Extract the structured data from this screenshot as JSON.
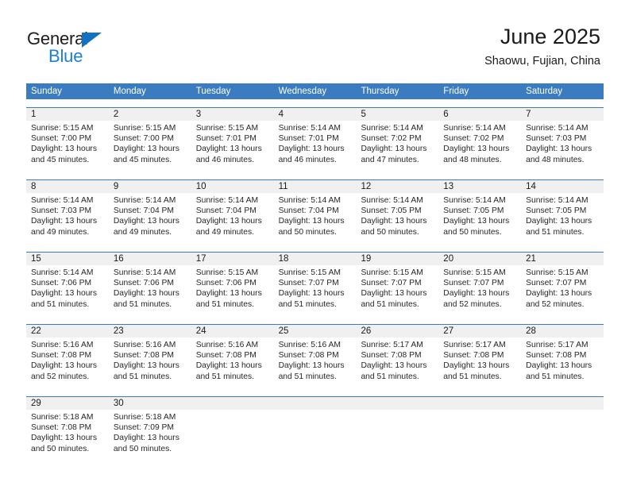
{
  "logo": {
    "word1": "General",
    "word2": "Blue",
    "triangle_color": "#1271c0",
    "blue_color": "#1b7fd4"
  },
  "header": {
    "title": "June 2025",
    "subtitle": "Shaowu, Fujian, China"
  },
  "theme": {
    "header_blue": "#3a7cbf",
    "daynum_band": "#f0f0f0",
    "text": "#1a1a1a"
  },
  "weekdays": [
    "Sunday",
    "Monday",
    "Tuesday",
    "Wednesday",
    "Thursday",
    "Friday",
    "Saturday"
  ],
  "weeks": [
    [
      {
        "day": "1",
        "sunrise": "Sunrise: 5:15 AM",
        "sunset": "Sunset: 7:00 PM",
        "daylight": "Daylight: 13 hours and 45 minutes."
      },
      {
        "day": "2",
        "sunrise": "Sunrise: 5:15 AM",
        "sunset": "Sunset: 7:00 PM",
        "daylight": "Daylight: 13 hours and 45 minutes."
      },
      {
        "day": "3",
        "sunrise": "Sunrise: 5:15 AM",
        "sunset": "Sunset: 7:01 PM",
        "daylight": "Daylight: 13 hours and 46 minutes."
      },
      {
        "day": "4",
        "sunrise": "Sunrise: 5:14 AM",
        "sunset": "Sunset: 7:01 PM",
        "daylight": "Daylight: 13 hours and 46 minutes."
      },
      {
        "day": "5",
        "sunrise": "Sunrise: 5:14 AM",
        "sunset": "Sunset: 7:02 PM",
        "daylight": "Daylight: 13 hours and 47 minutes."
      },
      {
        "day": "6",
        "sunrise": "Sunrise: 5:14 AM",
        "sunset": "Sunset: 7:02 PM",
        "daylight": "Daylight: 13 hours and 48 minutes."
      },
      {
        "day": "7",
        "sunrise": "Sunrise: 5:14 AM",
        "sunset": "Sunset: 7:03 PM",
        "daylight": "Daylight: 13 hours and 48 minutes."
      }
    ],
    [
      {
        "day": "8",
        "sunrise": "Sunrise: 5:14 AM",
        "sunset": "Sunset: 7:03 PM",
        "daylight": "Daylight: 13 hours and 49 minutes."
      },
      {
        "day": "9",
        "sunrise": "Sunrise: 5:14 AM",
        "sunset": "Sunset: 7:04 PM",
        "daylight": "Daylight: 13 hours and 49 minutes."
      },
      {
        "day": "10",
        "sunrise": "Sunrise: 5:14 AM",
        "sunset": "Sunset: 7:04 PM",
        "daylight": "Daylight: 13 hours and 49 minutes."
      },
      {
        "day": "11",
        "sunrise": "Sunrise: 5:14 AM",
        "sunset": "Sunset: 7:04 PM",
        "daylight": "Daylight: 13 hours and 50 minutes."
      },
      {
        "day": "12",
        "sunrise": "Sunrise: 5:14 AM",
        "sunset": "Sunset: 7:05 PM",
        "daylight": "Daylight: 13 hours and 50 minutes."
      },
      {
        "day": "13",
        "sunrise": "Sunrise: 5:14 AM",
        "sunset": "Sunset: 7:05 PM",
        "daylight": "Daylight: 13 hours and 50 minutes."
      },
      {
        "day": "14",
        "sunrise": "Sunrise: 5:14 AM",
        "sunset": "Sunset: 7:05 PM",
        "daylight": "Daylight: 13 hours and 51 minutes."
      }
    ],
    [
      {
        "day": "15",
        "sunrise": "Sunrise: 5:14 AM",
        "sunset": "Sunset: 7:06 PM",
        "daylight": "Daylight: 13 hours and 51 minutes."
      },
      {
        "day": "16",
        "sunrise": "Sunrise: 5:14 AM",
        "sunset": "Sunset: 7:06 PM",
        "daylight": "Daylight: 13 hours and 51 minutes."
      },
      {
        "day": "17",
        "sunrise": "Sunrise: 5:15 AM",
        "sunset": "Sunset: 7:06 PM",
        "daylight": "Daylight: 13 hours and 51 minutes."
      },
      {
        "day": "18",
        "sunrise": "Sunrise: 5:15 AM",
        "sunset": "Sunset: 7:07 PM",
        "daylight": "Daylight: 13 hours and 51 minutes."
      },
      {
        "day": "19",
        "sunrise": "Sunrise: 5:15 AM",
        "sunset": "Sunset: 7:07 PM",
        "daylight": "Daylight: 13 hours and 51 minutes."
      },
      {
        "day": "20",
        "sunrise": "Sunrise: 5:15 AM",
        "sunset": "Sunset: 7:07 PM",
        "daylight": "Daylight: 13 hours and 52 minutes."
      },
      {
        "day": "21",
        "sunrise": "Sunrise: 5:15 AM",
        "sunset": "Sunset: 7:07 PM",
        "daylight": "Daylight: 13 hours and 52 minutes."
      }
    ],
    [
      {
        "day": "22",
        "sunrise": "Sunrise: 5:16 AM",
        "sunset": "Sunset: 7:08 PM",
        "daylight": "Daylight: 13 hours and 52 minutes."
      },
      {
        "day": "23",
        "sunrise": "Sunrise: 5:16 AM",
        "sunset": "Sunset: 7:08 PM",
        "daylight": "Daylight: 13 hours and 51 minutes."
      },
      {
        "day": "24",
        "sunrise": "Sunrise: 5:16 AM",
        "sunset": "Sunset: 7:08 PM",
        "daylight": "Daylight: 13 hours and 51 minutes."
      },
      {
        "day": "25",
        "sunrise": "Sunrise: 5:16 AM",
        "sunset": "Sunset: 7:08 PM",
        "daylight": "Daylight: 13 hours and 51 minutes."
      },
      {
        "day": "26",
        "sunrise": "Sunrise: 5:17 AM",
        "sunset": "Sunset: 7:08 PM",
        "daylight": "Daylight: 13 hours and 51 minutes."
      },
      {
        "day": "27",
        "sunrise": "Sunrise: 5:17 AM",
        "sunset": "Sunset: 7:08 PM",
        "daylight": "Daylight: 13 hours and 51 minutes."
      },
      {
        "day": "28",
        "sunrise": "Sunrise: 5:17 AM",
        "sunset": "Sunset: 7:08 PM",
        "daylight": "Daylight: 13 hours and 51 minutes."
      }
    ],
    [
      {
        "day": "29",
        "sunrise": "Sunrise: 5:18 AM",
        "sunset": "Sunset: 7:08 PM",
        "daylight": "Daylight: 13 hours and 50 minutes."
      },
      {
        "day": "30",
        "sunrise": "Sunrise: 5:18 AM",
        "sunset": "Sunset: 7:09 PM",
        "daylight": "Daylight: 13 hours and 50 minutes."
      },
      {
        "day": "",
        "sunrise": "",
        "sunset": "",
        "daylight": ""
      },
      {
        "day": "",
        "sunrise": "",
        "sunset": "",
        "daylight": ""
      },
      {
        "day": "",
        "sunrise": "",
        "sunset": "",
        "daylight": ""
      },
      {
        "day": "",
        "sunrise": "",
        "sunset": "",
        "daylight": ""
      },
      {
        "day": "",
        "sunrise": "",
        "sunset": "",
        "daylight": ""
      }
    ]
  ]
}
